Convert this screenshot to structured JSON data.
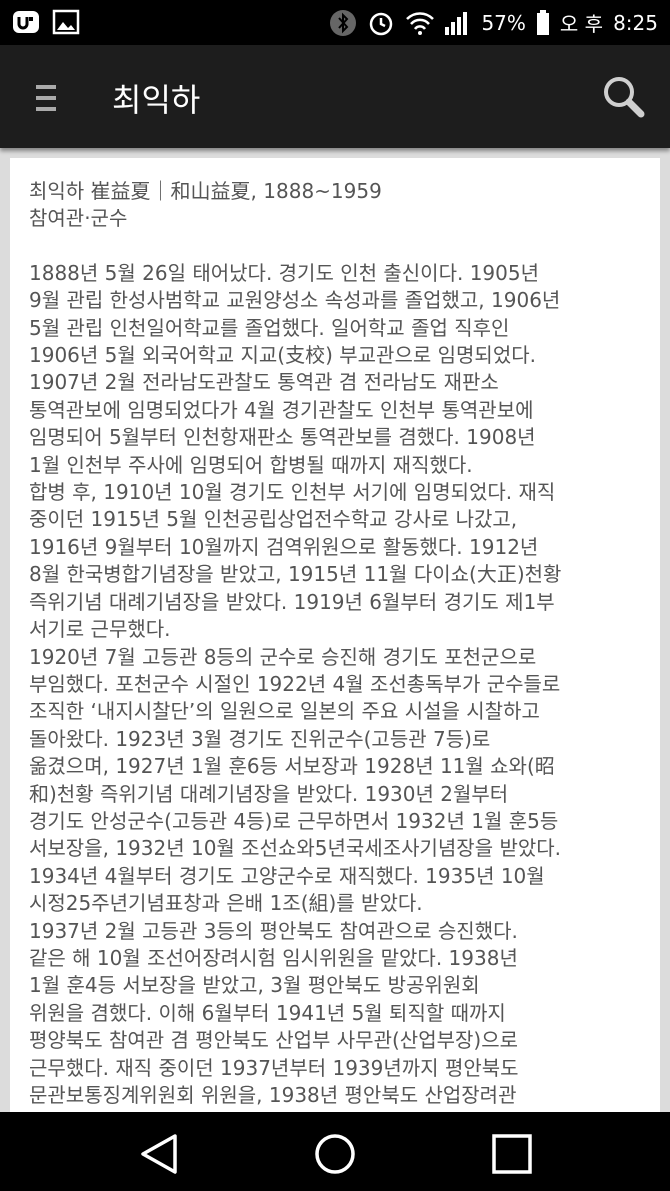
{
  "status_bar": {
    "battery_percent": "57%",
    "time_prefix": "오 후",
    "time": "8:25"
  },
  "app_bar": {
    "title": "최익하"
  },
  "article": {
    "header_line1": "최익하 崔益夏｜和山益夏, 1888~1959",
    "header_line2": "참여관·군수",
    "lines": [
      "1888년 5월 26일 태어났다. 경기도 인천 출신이다. 1905년",
      "9월 관립 한성사범학교 교원양성소 속성과를 졸업했고, 1906년",
      "5월 관립 인천일어학교를 졸업했다. 일어학교 졸업 직후인",
      "1906년 5월 외국어학교 지교(支校) 부교관으로 임명되었다.",
      "1907년 2월 전라남도관찰도 통역관 겸 전라남도 재판소",
      "통역관보에 임명되었다가 4월 경기관찰도 인천부 통역관보에",
      "임명되어 5월부터 인천항재판소 통역관보를 겸했다. 1908년",
      "1월 인천부 주사에 임명되어 합병될 때까지 재직했다.",
      "합병 후, 1910년 10월 경기도 인천부 서기에 임명되었다. 재직",
      "중이던 1915년 5월 인천공립상업전수학교 강사로 나갔고,",
      "1916년 9월부터 10월까지 검역위원으로 활동했다. 1912년",
      "8월 한국병합기념장을 받았고, 1915년 11월 다이쇼(大正)천황",
      "즉위기념 대례기념장을 받았다. 1919년 6월부터 경기도 제1부",
      "서기로 근무했다.",
      "1920년 7월 고등관 8등의 군수로 승진해 경기도 포천군으로",
      "부임했다. 포천군수 시절인 1922년 4월 조선총독부가 군수들로",
      "조직한 ‘내지시찰단’의 일원으로 일본의 주요 시설을 시찰하고",
      "돌아왔다. 1923년 3월 경기도 진위군수(고등관 7등)로",
      "옮겼으며, 1927년 1월 훈6등 서보장과 1928년 11월 쇼와(昭",
      "和)천황 즉위기념 대례기념장을 받았다. 1930년 2월부터",
      "경기도 안성군수(고등관 4등)로 근무하면서 1932년 1월 훈5등",
      "서보장을, 1932년 10월 조선쇼와5년국세조사기념장을 받았다.",
      "1934년 4월부터 경기도 고양군수로 재직했다. 1935년 10월",
      "시정25주년기념표창과 은배 1조(組)를 받았다.",
      "1937년 2월 고등관 3등의 평안북도 참여관으로 승진했다.",
      "같은 해 10월 조선어장려시험 임시위원을 맡았다. 1938년",
      "1월 훈4등 서보장을 받았고, 3월 평안북도 방공위원회",
      "위원을 겸했다. 이해 6월부터 1941년 5월 퇴직할 때까지",
      "평양북도 참여관 겸 평안북도 산업부 사무관(산업부장)으로",
      "근무했다. 재직 중이던 1937년부터 1939년까지 평안북도",
      "문관보통징계위원회 위원을, 1938년 평안북도 산업장려관"
    ]
  },
  "icons": {
    "status_left": [
      "app-logo-icon",
      "gallery-icon"
    ],
    "status_right": [
      "bluetooth-icon",
      "alarm-icon",
      "wifi-icon",
      "signal-icon",
      "battery-icon"
    ],
    "app_bar": [
      "menu-icon",
      "search-icon"
    ],
    "nav": [
      "back-icon",
      "home-icon",
      "recents-icon"
    ]
  }
}
